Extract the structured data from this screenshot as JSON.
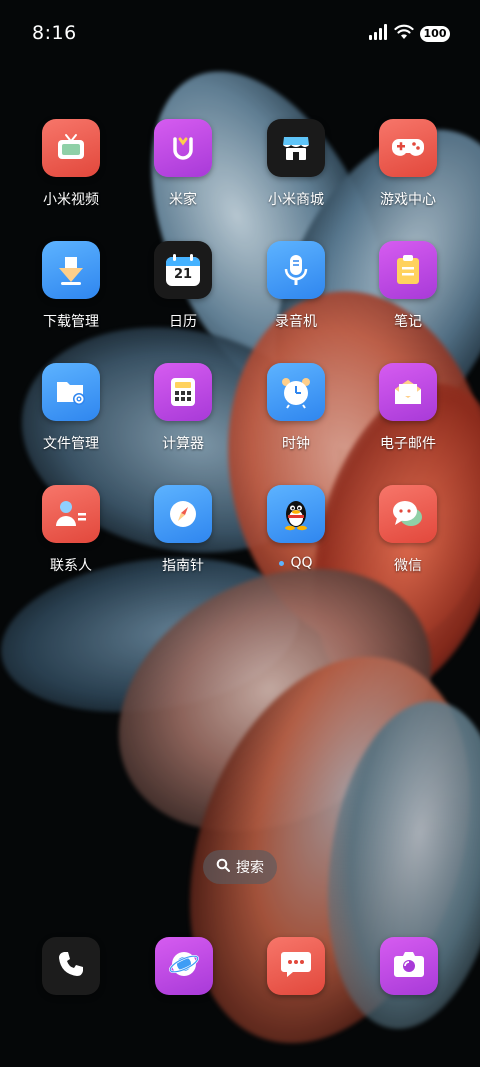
{
  "status_bar": {
    "time": "8:16",
    "battery": "100"
  },
  "apps": [
    {
      "label": "小米视频",
      "icon": "tv-icon",
      "color": "#ef5a4c"
    },
    {
      "label": "米家",
      "icon": "mijia-icon",
      "color": "#c24ae0"
    },
    {
      "label": "小米商城",
      "icon": "store-icon",
      "color": "#1b1b1b"
    },
    {
      "label": "游戏中心",
      "icon": "gamepad-icon",
      "color": "#ee5a50"
    },
    {
      "label": "下载管理",
      "icon": "download-icon",
      "color": "#3e9df5"
    },
    {
      "label": "日历",
      "icon": "calendar-icon",
      "color": "#1b1b1b",
      "date": "21"
    },
    {
      "label": "录音机",
      "icon": "microphone-icon",
      "color": "#3e9df5"
    },
    {
      "label": "笔记",
      "icon": "notes-icon",
      "color": "#c24ae0"
    },
    {
      "label": "文件管理",
      "icon": "folder-icon",
      "color": "#3e9df5"
    },
    {
      "label": "计算器",
      "icon": "calculator-icon",
      "color": "#c24ae0"
    },
    {
      "label": "时钟",
      "icon": "alarm-clock-icon",
      "color": "#3e9df5"
    },
    {
      "label": "电子邮件",
      "icon": "mail-icon",
      "color": "#c24ae0"
    },
    {
      "label": "联系人",
      "icon": "contacts-icon",
      "color": "#ee5a50"
    },
    {
      "label": "指南针",
      "icon": "compass-icon",
      "color": "#3e9df5"
    },
    {
      "label": "QQ",
      "icon": "qq-penguin-icon",
      "color": "#3e9df5"
    },
    {
      "label": "微信",
      "icon": "wechat-icon",
      "color": "#ee5a50"
    }
  ],
  "search": {
    "label": "搜索"
  },
  "dock": [
    {
      "icon": "phone-icon",
      "color": "#1b1b1b"
    },
    {
      "icon": "browser-icon",
      "color": "#c24ae0"
    },
    {
      "icon": "messages-icon",
      "color": "#ee5a50"
    },
    {
      "icon": "camera-icon",
      "color": "#c24ae0"
    }
  ]
}
